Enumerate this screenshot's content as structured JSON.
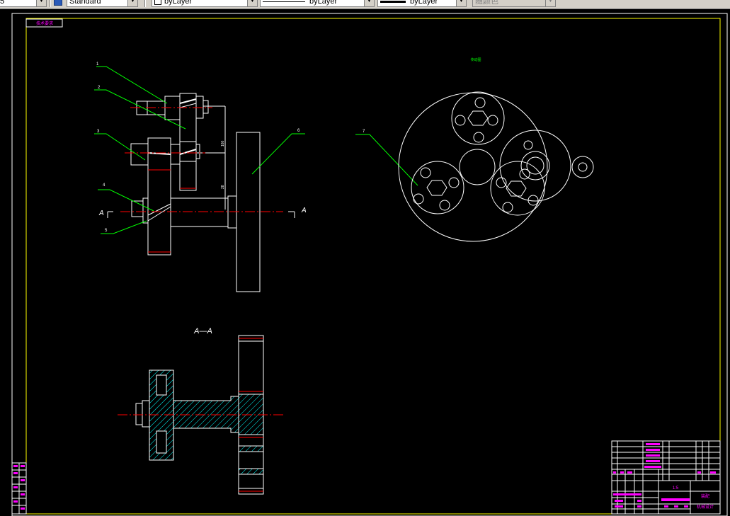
{
  "toolbar": {
    "partial_left_value": "5",
    "text_style": "Standard",
    "layer": "byLayer",
    "linetype": "byLayer",
    "lineweight": "byLayer",
    "plot_style": "随颜色"
  },
  "drawing": {
    "title_tag": "技术要求",
    "section_label": "A—A",
    "section_marker": "A",
    "top_label": "传动图",
    "leaders": [
      "1",
      "2",
      "3",
      "4",
      "5",
      "6",
      "7"
    ],
    "dims": [
      "160",
      "28"
    ]
  },
  "title_block": {
    "scale": "1:5",
    "part": "装配",
    "company": "机械设计"
  },
  "colors": {
    "background": "#000000",
    "border": "#ffff00",
    "geometry": "#ffffff",
    "center_line": "#ff0000",
    "leader": "#00ff00",
    "hatch": "#00ffff",
    "title_text": "#ff00ff"
  }
}
